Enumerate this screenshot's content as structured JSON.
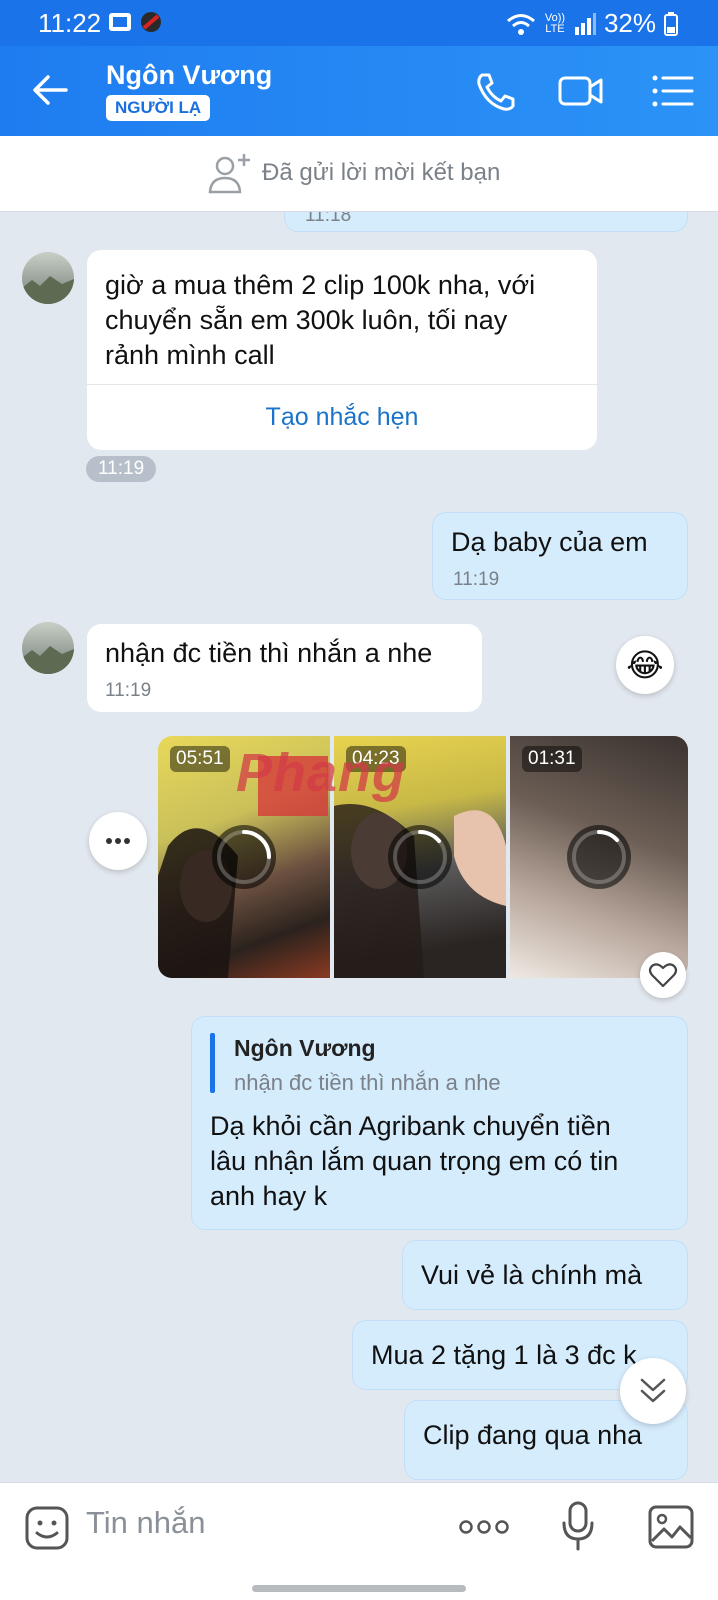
{
  "status_bar": {
    "time": "11:22",
    "battery": "32%",
    "network": "Vo)) LTE"
  },
  "header": {
    "title": "Ngôn Vương",
    "badge": "NGƯỜI LẠ"
  },
  "friend_request": {
    "text": "Đã gửi lời mời kết bạn"
  },
  "messages": [
    {
      "direction": "out",
      "time": "11:18"
    },
    {
      "direction": "in",
      "text_lines": [
        "giờ a mua thêm 2 clip 100k nha, với",
        "chuyển sẵn em 300k luôn, tối nay",
        "rảnh mình call"
      ],
      "action": "Tạo nhắc hẹn",
      "time": "11:19"
    },
    {
      "direction": "out",
      "text": "Dạ baby của em",
      "time": "11:19"
    },
    {
      "direction": "in",
      "text": "nhận đc tiền thì nhắn a nhe",
      "time": "11:19",
      "reaction": "😂"
    },
    {
      "direction": "in",
      "type": "videos",
      "videos": [
        {
          "duration": "05:51"
        },
        {
          "duration": "04:23"
        },
        {
          "duration": "01:31"
        }
      ]
    },
    {
      "direction": "out",
      "reply_to": {
        "name": "Ngôn Vương",
        "text": "nhận đc tiền thì nhắn a nhe"
      },
      "text_lines": [
        "Dạ khỏi cần Agribank chuyển tiền",
        "lâu nhận lắm quan trọng em có tin",
        "anh hay k"
      ]
    },
    {
      "direction": "out",
      "text": "Vui vẻ là chính mà"
    },
    {
      "direction": "out",
      "text": "Mua 2 tặng 1 là 3 đc k"
    },
    {
      "direction": "out",
      "text": "Clip đang qua nha"
    }
  ],
  "watermark": "Phang",
  "input": {
    "placeholder": "Tin nhắn"
  },
  "colors": {
    "header": "#1e7cf0",
    "outgoing_bubble": "#d5ecfd",
    "incoming_bubble": "#ffffff",
    "chat_bg": "#e2e8ef",
    "link": "#1a73c8"
  }
}
